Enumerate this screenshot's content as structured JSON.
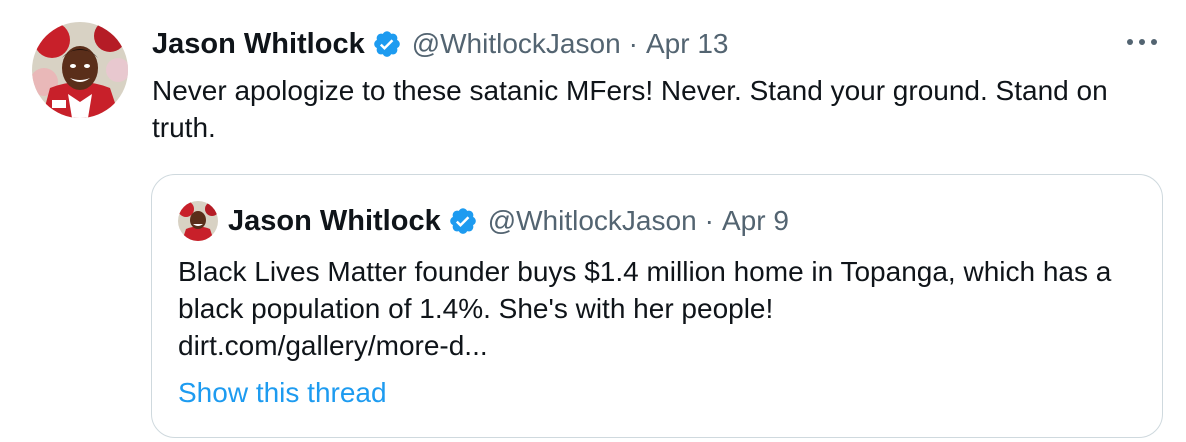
{
  "tweet": {
    "author_name": "Jason Whitlock",
    "author_handle": "@WhitlockJason",
    "separator": "·",
    "date": "Apr 13",
    "text": "Never apologize to these satanic MFers! Never. Stand your ground. Stand on truth.",
    "more_icon": "more-horizontal-icon",
    "verified_icon": "verified-badge-icon"
  },
  "quoted_tweet": {
    "author_name": "Jason Whitlock",
    "author_handle": "@WhitlockJason",
    "separator": "·",
    "date": "Apr 9",
    "text": "Black Lives Matter founder buys $1.4 million home in Topanga, which has a black population of 1.4%. She's with her people!",
    "link": "dirt.com/gallery/more-d...",
    "show_thread": "Show this thread"
  },
  "colors": {
    "text_primary": "#0f1419",
    "text_secondary": "#536471",
    "accent": "#1d9bf0",
    "border": "#cfd9de"
  }
}
